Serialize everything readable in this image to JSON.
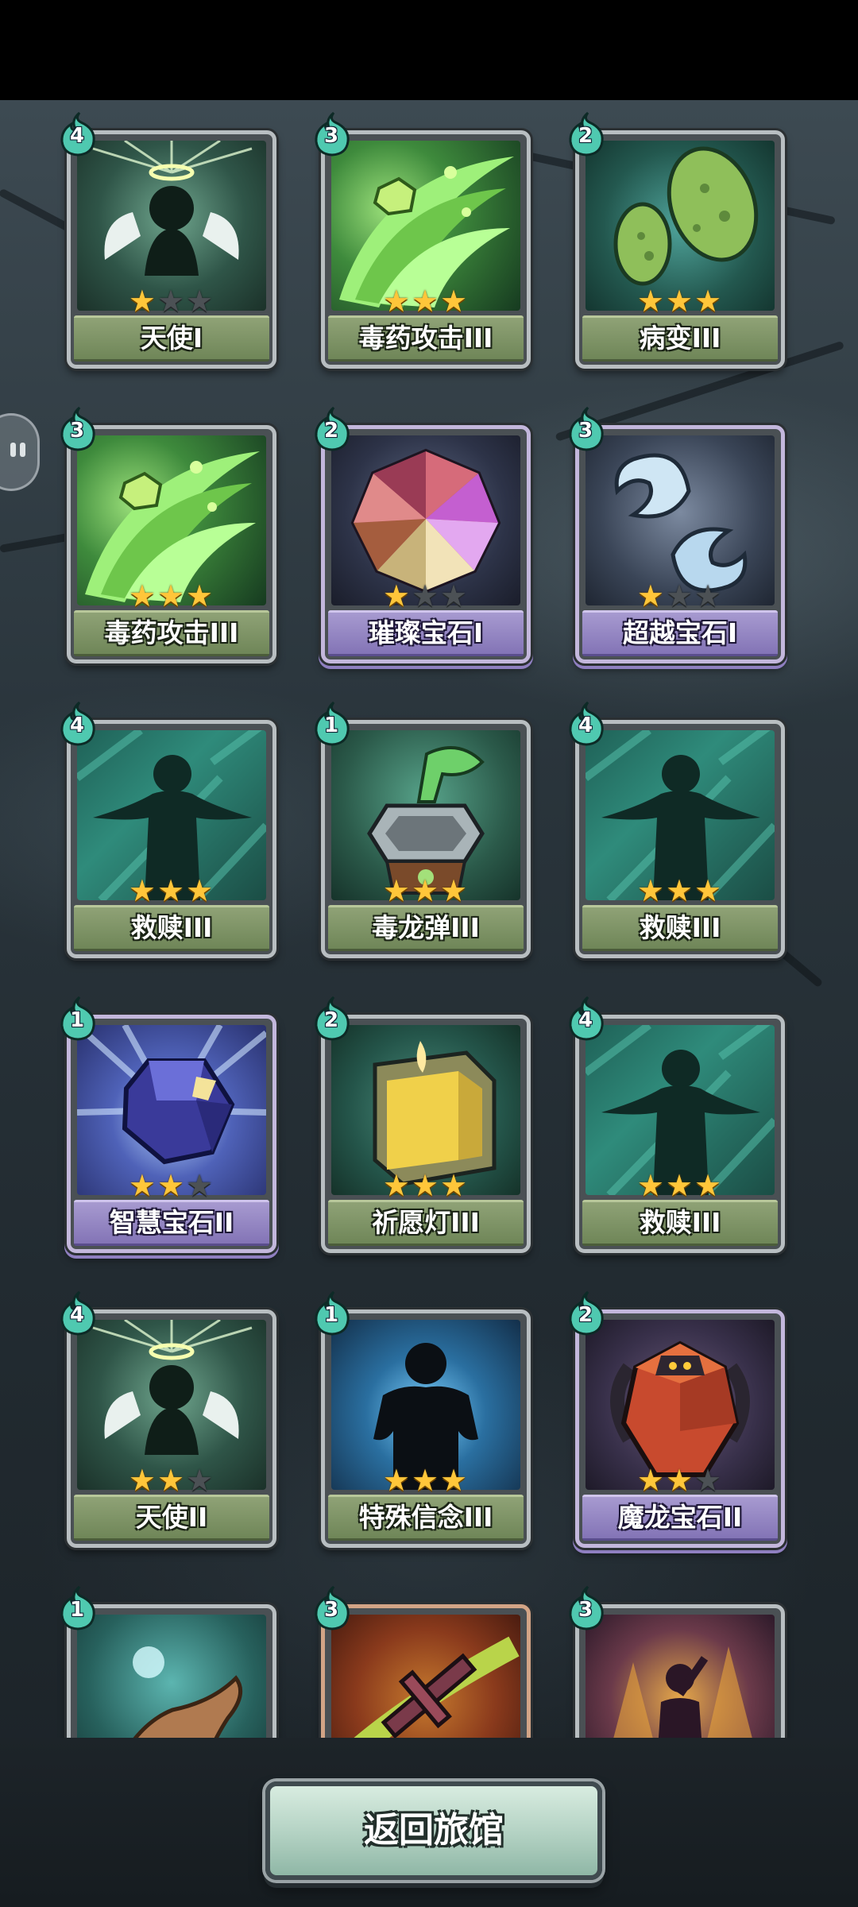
{
  "colors": {
    "star_on": "#ffc63a",
    "star_off": "#4c5155",
    "nameplate_green": "#7d9465",
    "nameplate_purple": "#9486c4",
    "cost_badge": "#4fc9b0"
  },
  "cards": [
    {
      "cost": "4",
      "name": "天使I",
      "stars": 1,
      "plate": "green",
      "art": "angel-icon"
    },
    {
      "cost": "3",
      "name": "毒药攻击III",
      "stars": 3,
      "plate": "green",
      "art": "poison-attack-icon"
    },
    {
      "cost": "2",
      "name": "病变III",
      "stars": 3,
      "plate": "green",
      "art": "virus-icon"
    },
    {
      "cost": "3",
      "name": "毒药攻击III",
      "stars": 3,
      "plate": "green",
      "art": "poison-attack-icon"
    },
    {
      "cost": "2",
      "name": "璀璨宝石I",
      "stars": 1,
      "plate": "purple",
      "art": "brilliant-gem-icon"
    },
    {
      "cost": "3",
      "name": "超越宝石I",
      "stars": 1,
      "plate": "purple",
      "art": "transcend-gem-icon"
    },
    {
      "cost": "4",
      "name": "救赎III",
      "stars": 3,
      "plate": "green",
      "art": "redemption-icon"
    },
    {
      "cost": "1",
      "name": "毒龙弹III",
      "stars": 3,
      "plate": "green",
      "art": "poison-dragon-bomb-icon"
    },
    {
      "cost": "4",
      "name": "救赎III",
      "stars": 3,
      "plate": "green",
      "art": "redemption-icon"
    },
    {
      "cost": "1",
      "name": "智慧宝石II",
      "stars": 2,
      "plate": "purple",
      "art": "wisdom-gem-icon"
    },
    {
      "cost": "2",
      "name": "祈愿灯III",
      "stars": 3,
      "plate": "green",
      "art": "wish-lantern-icon"
    },
    {
      "cost": "4",
      "name": "救赎III",
      "stars": 3,
      "plate": "green",
      "art": "redemption-icon"
    },
    {
      "cost": "4",
      "name": "天使II",
      "stars": 2,
      "plate": "green",
      "art": "angel-icon"
    },
    {
      "cost": "1",
      "name": "特殊信念III",
      "stars": 3,
      "plate": "green",
      "art": "special-belief-icon"
    },
    {
      "cost": "2",
      "name": "魔龙宝石II",
      "stars": 2,
      "plate": "purple",
      "art": "demon-dragon-gem-icon"
    },
    {
      "cost": "1",
      "name": "",
      "stars": 0,
      "plate": "green",
      "art": "glowing-hand-icon"
    },
    {
      "cost": "3",
      "name": "",
      "stars": 0,
      "plate": "copper",
      "art": "sword-icon"
    },
    {
      "cost": "3",
      "name": "",
      "stars": 0,
      "plate": "green",
      "art": "shadow-figure-icon"
    }
  ],
  "return_button": {
    "label": "返回旅馆"
  }
}
